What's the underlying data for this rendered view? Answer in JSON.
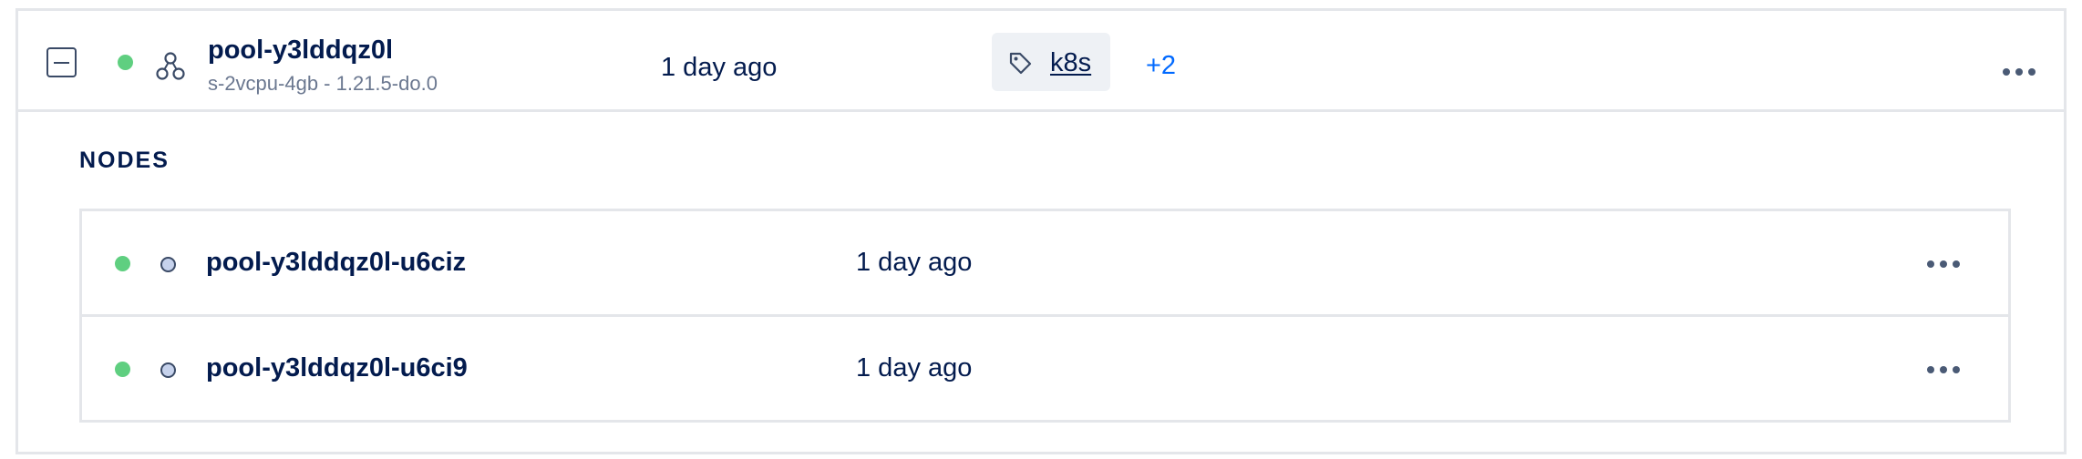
{
  "pool": {
    "name": "pool-y3lddqz0l",
    "subtitle": "s-2vcpu-4gb - 1.21.5-do.0",
    "age": "1 day ago",
    "status": "running",
    "status_color": "#5fcf80",
    "icon": "node-pool-icon",
    "tag": {
      "icon": "tag-icon",
      "label": "k8s"
    },
    "more_tags": "+2",
    "actions_icon": "more-horizontal-icon"
  },
  "nodes": {
    "heading": "NODES",
    "rows": [
      {
        "name": "pool-y3lddqz0l-u6ciz",
        "age": "1 day ago",
        "status": "running",
        "status_color": "#5fcf80"
      },
      {
        "name": "pool-y3lddqz0l-u6ci9",
        "age": "1 day ago",
        "status": "running",
        "status_color": "#5fcf80"
      }
    ]
  },
  "colors": {
    "accent": "#0069ff",
    "text": "#031b4e",
    "muted": "#6b7890",
    "border": "#e4e6ea",
    "tag_bg": "#eef1f5"
  }
}
